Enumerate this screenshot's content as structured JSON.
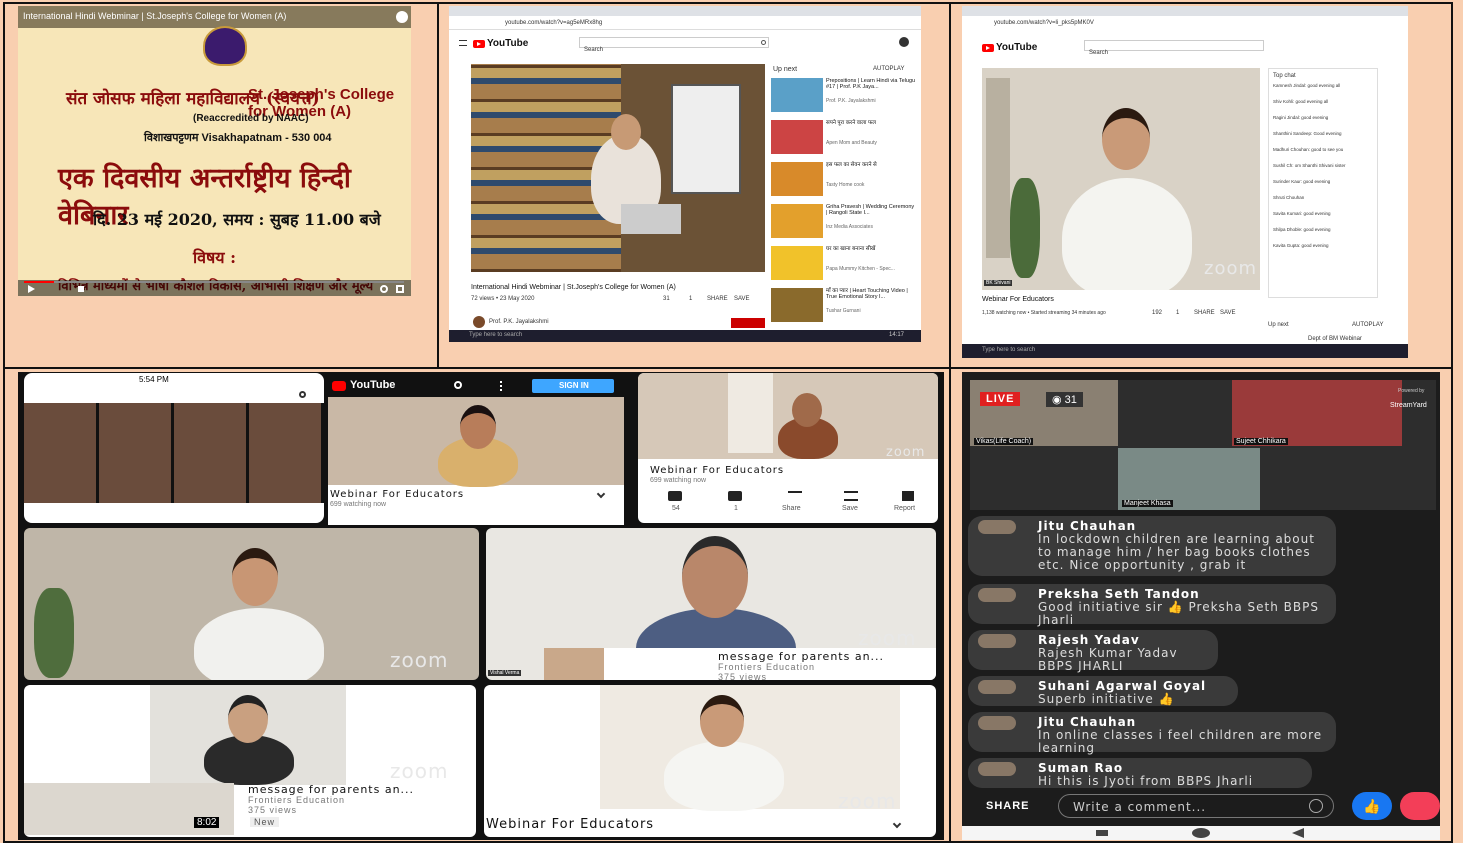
{
  "panel1": {
    "title": "International Hindi Webminar | St.Joseph's College for Women (A)",
    "college_hindi": "संत जोसफ महिला महाविद्यालय (स्वयत्त)",
    "college_en": "St. Joseph's College for Women (A)",
    "naac": "(Reaccredited by NAAC)",
    "city": "विशाखपट्टणम Visakhapatnam - 530 004",
    "webinar": "एक दिवसीय अन्तर्राष्ट्रीय हिन्दी वेबिनार",
    "date": "दि. 23 मई 2020,  समय : सुबह 11.00 बजे",
    "subject_label": "विषय :",
    "subject": "विभिन्न माध्यमों से भाषा कौशल विकास, आभासी शिक्षण और मूल्य"
  },
  "panel2": {
    "search_placeholder": "Search",
    "url": "youtube.com/watch?v=ag5eMRx8hg",
    "up_next": "Up next",
    "autoplay": "AUTOPLAY",
    "video_title": "International Hindi Webminar | St.Joseph's College for Women (A)",
    "views": "72 views • 23 May 2020",
    "like": "31",
    "dislike": "1",
    "share": "SHARE",
    "save": "SAVE",
    "channel": "Prof. P.K. Jayalakshmi",
    "taskbar_search": "Type here to search",
    "time": "14:17",
    "recs": [
      {
        "title": "Prepositions | Learn Hindi via Telugu #17 | Prof. P.K Jaya...",
        "meta": "Prof. P.K. Jayalakshmi"
      },
      {
        "title": "सपने पूरा करने वाला फल",
        "meta": "Apen Mom and Beauty"
      },
      {
        "title": "इस फल का सेवन करने से",
        "meta": "Tasty Home cook"
      },
      {
        "title": "Griha Pravesh | Wedding Ceremony | Rangoli State I...",
        "meta": "Inz Media Associates"
      },
      {
        "title": "घर का खाना बनाना सीखें",
        "meta": "Papa Mummy Kitchen - Spec..."
      },
      {
        "title": "माँ का प्यार | Heart Touching Video | True Emotional Story I...",
        "meta": "Tushar Gurnani"
      }
    ]
  },
  "panel3": {
    "url": "youtube.com/watch?v=li_pks5pMK0V",
    "search_placeholder": "Search",
    "top_chat": "Top chat",
    "video_title": "Webinar For Educators",
    "views": "1,138 watching now • Started streaming 34 minutes ago",
    "like": "192",
    "dislike": "1",
    "share": "SHARE",
    "save": "SAVE",
    "up_next": "Up next",
    "autoplay": "AUTOPLAY",
    "rec": "Dept of BM Webinar",
    "zoom": "zoom",
    "speaker": "BK Shivani",
    "taskbar_search": "Type here to search",
    "chat": [
      "Kamnesh Jindal: good evening all",
      "Shiv Kohli: good evening all",
      "Ragini Jindal: good evening",
      "Shanthini Sandeep: Good evening",
      "Madhuri Chouhan: good to see you",
      "Sushil Ch: om Shanthi Shivani sister",
      "Surinder Kaur: good evening",
      "Shruti Chouhan",
      "Savita Kumari: good evening",
      "Shilpa Dhoble: good evening",
      "Kavita Gupta: good evening"
    ]
  },
  "panel4": {
    "status_time": "5:54 PM",
    "youtube": "YouTube",
    "sign_in": "SIGN IN",
    "webinar_title_a": "Webinar For Educators",
    "watching_a": "699 watching now",
    "webinar_title_b": "Webinar For Educators",
    "watching_b": "699 watching now",
    "likes": "54",
    "dislikes": "1",
    "share": "Share",
    "save": "Save",
    "report": "Report",
    "zoom": "zoom",
    "message_title": "message for parents an...",
    "channel": "Frontiers Education",
    "views": "375 views",
    "new": "New",
    "duration": "8:02",
    "educators": "Webinar For Educators",
    "speaker_vishal": "Vishal Verma"
  },
  "panel5": {
    "live": "LIVE",
    "viewers": "31",
    "powered": "Powered by",
    "brand": "StreamYard",
    "p1": "Vikas(Life Coach)",
    "p2": "Sujeet Chhikara",
    "p3": "Manjeet Khasa",
    "share": "SHARE",
    "write": "Write a comment...",
    "comments": [
      {
        "name": "Jitu Chauhan",
        "text": "In lockdown children are learning about  to manage  him / her bag books clothes etc. Nice opportunity , grab it"
      },
      {
        "name": "Preksha Seth Tandon",
        "text": "Good initiative sir 👍 Preksha Seth BBPS Jharli"
      },
      {
        "name": "Rajesh Yadav",
        "text": "Rajesh Kumar Yadav BBPS JHARLI"
      },
      {
        "name": "Suhani Agarwal Goyal",
        "text": "Superb initiative 👍"
      },
      {
        "name": "Jitu Chauhan",
        "text": "In online classes i feel children are more learning"
      },
      {
        "name": "Suman Rao",
        "text": "Hi this is Jyoti from BBPS Jharli"
      }
    ]
  }
}
